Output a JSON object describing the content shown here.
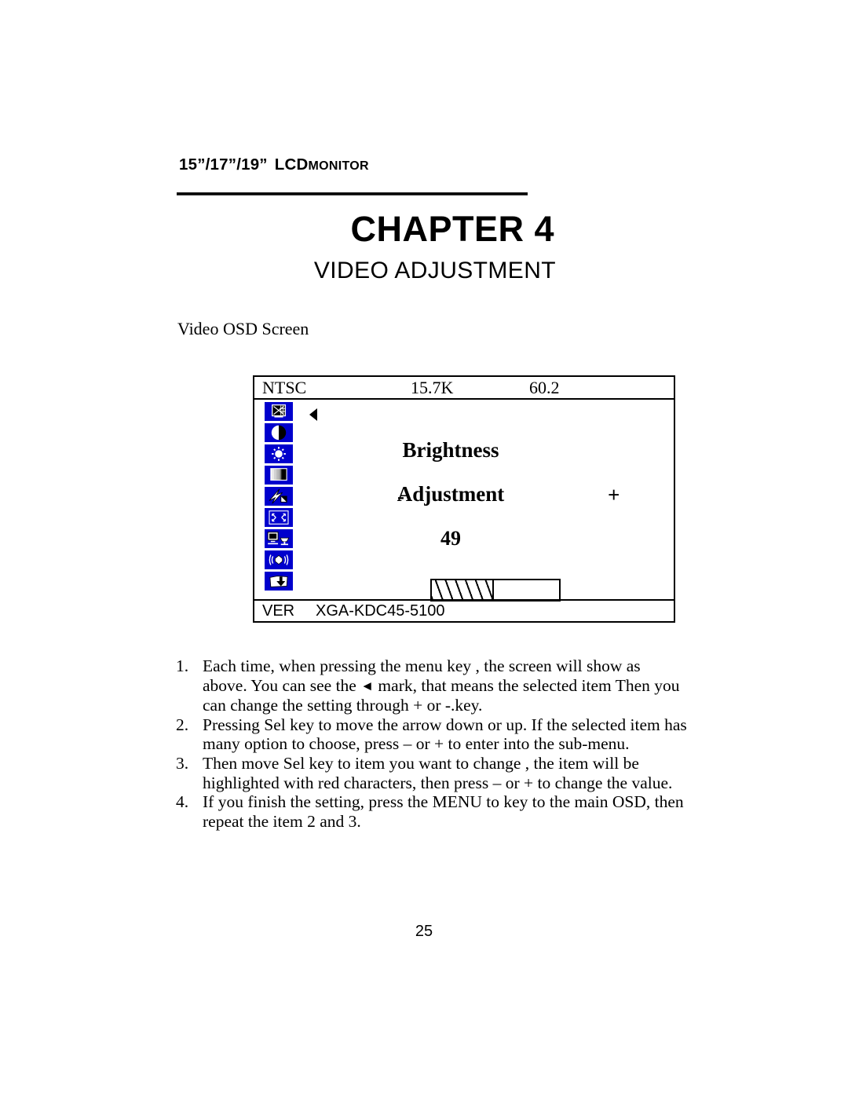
{
  "header": {
    "sizes": "15”/17”/19”",
    "lcd": "LCD",
    "monitor": "MONITOR"
  },
  "chapter": {
    "title": "CHAPTER 4",
    "subtitle": "VIDEO ADJUSTMENT"
  },
  "caption": "Video OSD Screen",
  "osd": {
    "header": {
      "signal": "NTSC",
      "h_frequency": "15.7K",
      "v_frequency": "60.2"
    },
    "footer": {
      "ver_label": "VER",
      "model": "XGA-KDC45-5100"
    },
    "icons": [
      {
        "name": "screen-geometry-icon",
        "label": "Screen / Picture"
      },
      {
        "name": "contrast-icon",
        "label": "Contrast"
      },
      {
        "name": "brightness-icon",
        "label": "Brightness"
      },
      {
        "name": "gamma-grayscale-icon",
        "label": "Gamma / Grayscale"
      },
      {
        "name": "sharpness-icon",
        "label": "Sharpness"
      },
      {
        "name": "expand-size-icon",
        "label": "Size / Position"
      },
      {
        "name": "monitor-source-icon",
        "label": "Input Source"
      },
      {
        "name": "audio-icon",
        "label": "Audio"
      },
      {
        "name": "save-exit-icon",
        "label": "Save / Exit"
      }
    ],
    "selected_icon_index": 0,
    "menu": {
      "item_label": "Brightness",
      "action_label": "Adjustment",
      "decrease_label": "-",
      "increase_label": "+",
      "value": "49",
      "bar_percent": 49
    }
  },
  "steps": [
    {
      "number": "1.",
      "text_before_mark": "Each time, when pressing the menu key , the screen will show as above. You can see the ",
      "mark": "◄",
      "text_after_mark": " mark, that means the selected item Then you can change the setting through + or -.key."
    },
    {
      "number": "2.",
      "text": "Pressing Sel key to move the arrow down or up. If the selected item has many option to choose, press – or + to enter into the sub-menu."
    },
    {
      "number": "3.",
      "text": "Then move Sel key to item you want to change , the item will be highlighted with red characters, then press – or + to change the value."
    },
    {
      "number": "4.",
      "text": "If you finish the setting, press the MENU to key to the main OSD, then repeat the item 2 and 3."
    }
  ],
  "page_number": "25",
  "colors": {
    "icon_background": "#0000CD",
    "ink": "#000000",
    "paper": "#FFFFFF"
  }
}
